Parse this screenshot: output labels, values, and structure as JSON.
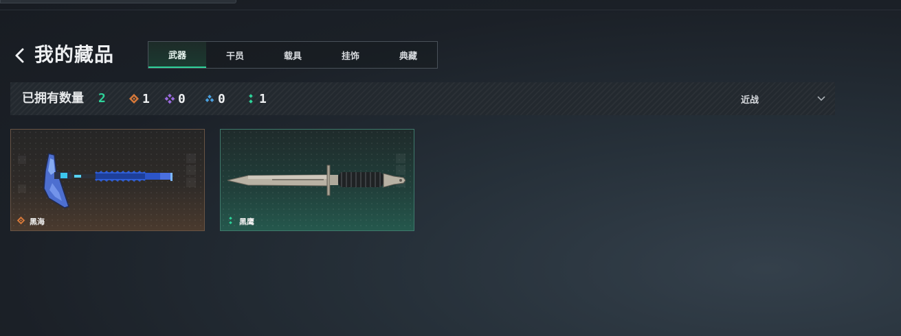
{
  "page": {
    "title": "我的藏品",
    "tabs": [
      {
        "label": "武器",
        "active": true
      },
      {
        "label": "干员",
        "active": false
      },
      {
        "label": "载具",
        "active": false
      },
      {
        "label": "挂饰",
        "active": false
      },
      {
        "label": "典藏",
        "active": false
      }
    ]
  },
  "filter": {
    "owned_label": "已拥有数量",
    "owned_count": "2",
    "rarity_counts": [
      {
        "icon": "orange-diamond-icon",
        "color": "#d6783a",
        "count": "1"
      },
      {
        "icon": "purple-diamond-icon",
        "color": "#9b6be0",
        "count": "0"
      },
      {
        "icon": "blue-triangle-icon",
        "color": "#4aa0e0",
        "count": "0"
      },
      {
        "icon": "green-dots-icon",
        "color": "#2ed39a",
        "count": "1"
      }
    ],
    "category": "近战"
  },
  "items": [
    {
      "name": "黑海",
      "rarity_color": "#d6783a",
      "weapon": "axe-icon"
    },
    {
      "name": "黑鹰",
      "rarity_color": "#2ed39a",
      "weapon": "knife-icon"
    }
  ],
  "colors": {
    "accent": "#2ed39a",
    "orange": "#d6783a",
    "purple": "#9b6be0",
    "blue": "#4aa0e0"
  }
}
